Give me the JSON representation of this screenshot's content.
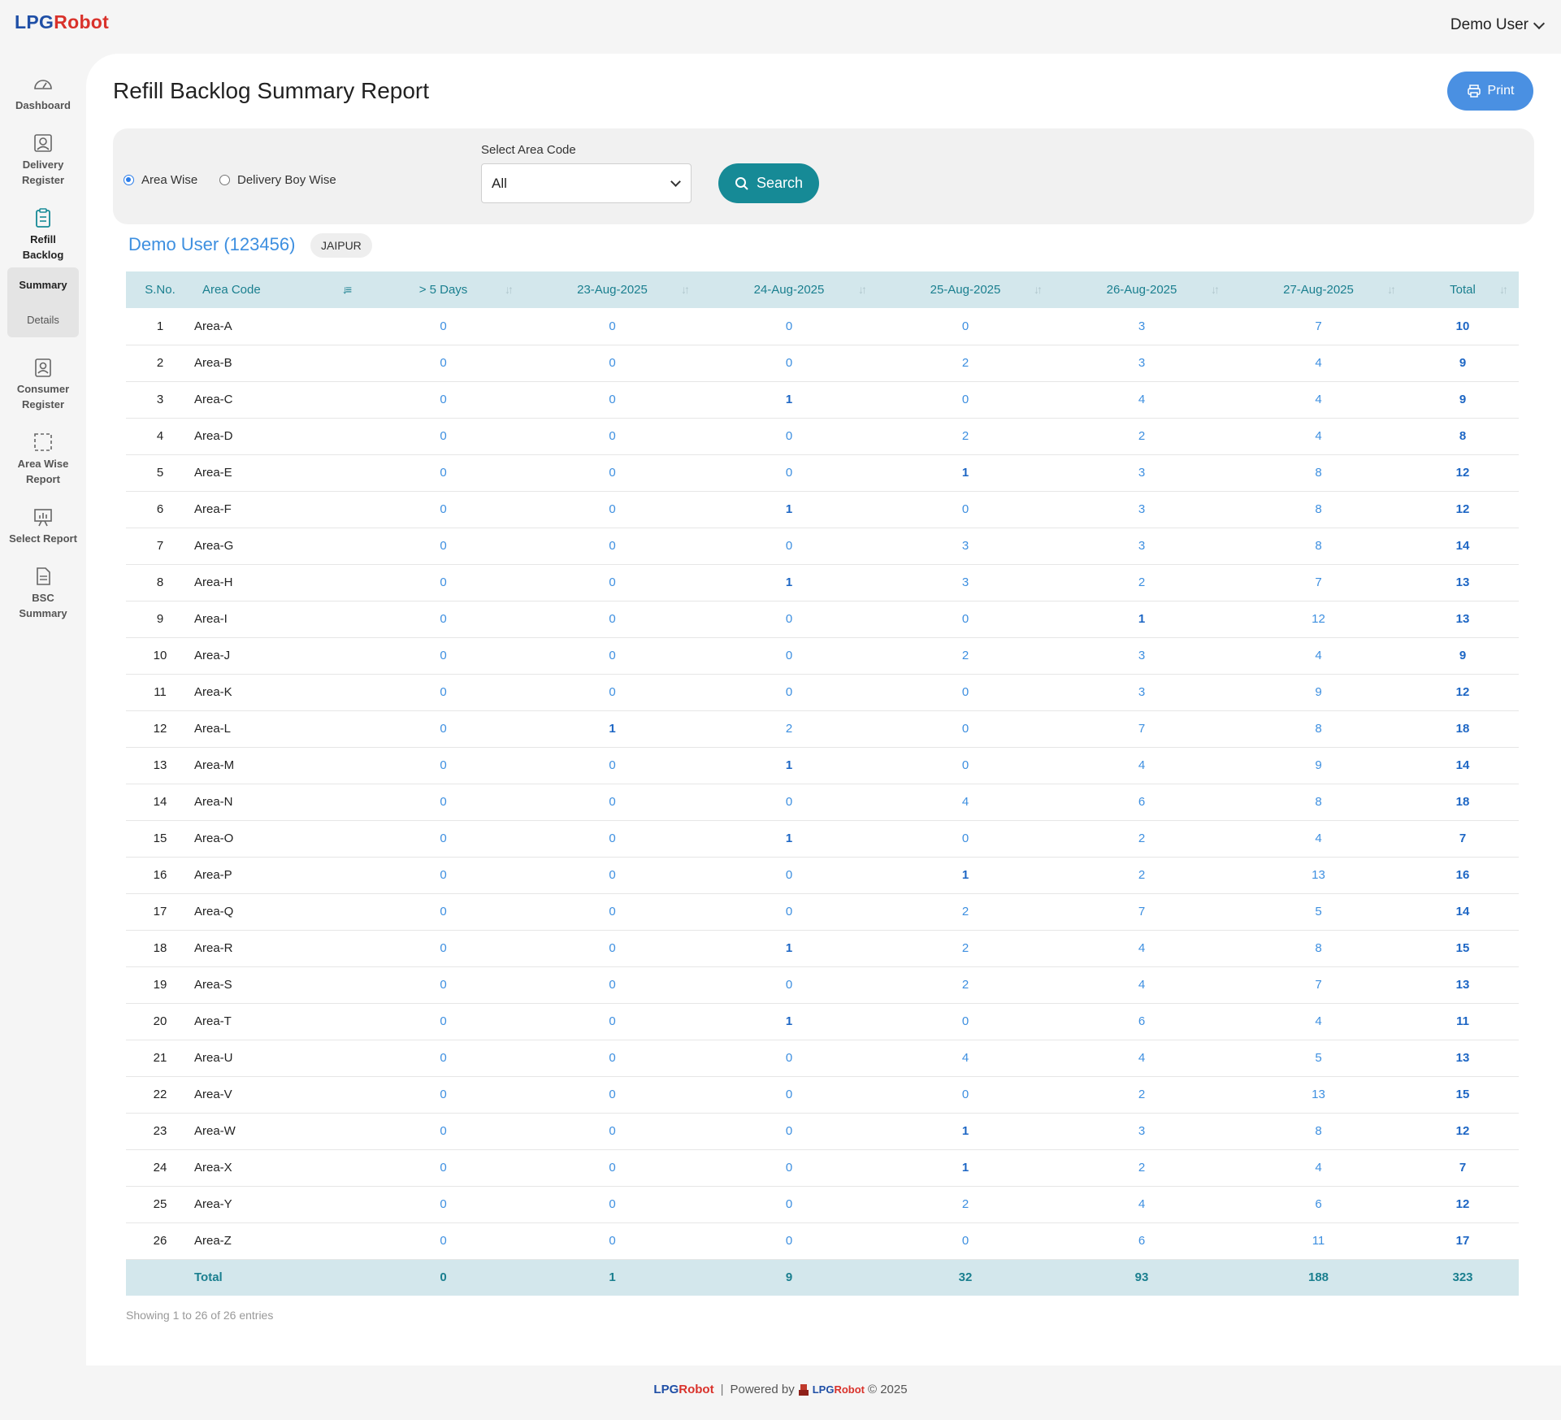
{
  "brand": {
    "lpg": "LPG",
    "robot": "Robot"
  },
  "user_menu": {
    "label": "Demo User"
  },
  "sidebar": {
    "items": [
      {
        "label_1": "Dashboard",
        "label_2": "",
        "icon": "dashboard-icon"
      },
      {
        "label_1": "Delivery",
        "label_2": "Register",
        "icon": "delivery-register-icon"
      },
      {
        "label_1": "Refill",
        "label_2": "Backlog",
        "icon": "clipboard-icon"
      },
      {
        "label_1": "Consumer",
        "label_2": "Register",
        "icon": "consumer-register-icon"
      },
      {
        "label_1": "Area Wise",
        "label_2": "Report",
        "icon": "area-select-icon"
      },
      {
        "label_1": "Select Report",
        "label_2": "",
        "icon": "presentation-chart-icon"
      },
      {
        "label_1": "BSC",
        "label_2": "Summary",
        "icon": "document-icon"
      }
    ],
    "sub": {
      "summary": "Summary",
      "details": "Details"
    }
  },
  "page": {
    "title": "Refill Backlog Summary Report",
    "print_label": "Print"
  },
  "filters": {
    "radio_area": "Area Wise",
    "radio_boy": "Delivery Boy Wise",
    "select_label": "Select Area Code",
    "select_value": "All",
    "search_label": "Search"
  },
  "report": {
    "user": "Demo User (123456)",
    "city": "JAIPUR"
  },
  "table": {
    "headers": [
      "S.No.",
      "Area Code",
      "> 5 Days",
      "23-Aug-2025",
      "24-Aug-2025",
      "25-Aug-2025",
      "26-Aug-2025",
      "27-Aug-2025",
      "Total"
    ],
    "rows": [
      [
        "1",
        "Area-A",
        "0",
        "0",
        "0",
        "0",
        "3",
        "7",
        "10"
      ],
      [
        "2",
        "Area-B",
        "0",
        "0",
        "0",
        "2",
        "3",
        "4",
        "9"
      ],
      [
        "3",
        "Area-C",
        "0",
        "0",
        "1",
        "0",
        "4",
        "4",
        "9"
      ],
      [
        "4",
        "Area-D",
        "0",
        "0",
        "0",
        "2",
        "2",
        "4",
        "8"
      ],
      [
        "5",
        "Area-E",
        "0",
        "0",
        "0",
        "1",
        "3",
        "8",
        "12"
      ],
      [
        "6",
        "Area-F",
        "0",
        "0",
        "1",
        "0",
        "3",
        "8",
        "12"
      ],
      [
        "7",
        "Area-G",
        "0",
        "0",
        "0",
        "3",
        "3",
        "8",
        "14"
      ],
      [
        "8",
        "Area-H",
        "0",
        "0",
        "1",
        "3",
        "2",
        "7",
        "13"
      ],
      [
        "9",
        "Area-I",
        "0",
        "0",
        "0",
        "0",
        "1",
        "12",
        "13"
      ],
      [
        "10",
        "Area-J",
        "0",
        "0",
        "0",
        "2",
        "3",
        "4",
        "9"
      ],
      [
        "11",
        "Area-K",
        "0",
        "0",
        "0",
        "0",
        "3",
        "9",
        "12"
      ],
      [
        "12",
        "Area-L",
        "0",
        "1",
        "2",
        "0",
        "7",
        "8",
        "18"
      ],
      [
        "13",
        "Area-M",
        "0",
        "0",
        "1",
        "0",
        "4",
        "9",
        "14"
      ],
      [
        "14",
        "Area-N",
        "0",
        "0",
        "0",
        "4",
        "6",
        "8",
        "18"
      ],
      [
        "15",
        "Area-O",
        "0",
        "0",
        "1",
        "0",
        "2",
        "4",
        "7"
      ],
      [
        "16",
        "Area-P",
        "0",
        "0",
        "0",
        "1",
        "2",
        "13",
        "16"
      ],
      [
        "17",
        "Area-Q",
        "0",
        "0",
        "0",
        "2",
        "7",
        "5",
        "14"
      ],
      [
        "18",
        "Area-R",
        "0",
        "0",
        "1",
        "2",
        "4",
        "8",
        "15"
      ],
      [
        "19",
        "Area-S",
        "0",
        "0",
        "0",
        "2",
        "4",
        "7",
        "13"
      ],
      [
        "20",
        "Area-T",
        "0",
        "0",
        "1",
        "0",
        "6",
        "4",
        "11"
      ],
      [
        "21",
        "Area-U",
        "0",
        "0",
        "0",
        "4",
        "4",
        "5",
        "13"
      ],
      [
        "22",
        "Area-V",
        "0",
        "0",
        "0",
        "0",
        "2",
        "13",
        "15"
      ],
      [
        "23",
        "Area-W",
        "0",
        "0",
        "0",
        "1",
        "3",
        "8",
        "12"
      ],
      [
        "24",
        "Area-X",
        "0",
        "0",
        "0",
        "1",
        "2",
        "4",
        "7"
      ],
      [
        "25",
        "Area-Y",
        "0",
        "0",
        "0",
        "2",
        "4",
        "6",
        "12"
      ],
      [
        "26",
        "Area-Z",
        "0",
        "0",
        "0",
        "0",
        "6",
        "11",
        "17"
      ]
    ],
    "total_row": [
      "",
      "Total",
      "0",
      "1",
      "9",
      "32",
      "93",
      "188",
      "323"
    ],
    "entries_text": "Showing 1 to 26 of 26 entries"
  },
  "footer": {
    "powered": "Powered by",
    "year": "© 2025"
  },
  "colors": {
    "accent": "#168a96",
    "link": "#3d8fe0",
    "header_bg": "#d3e7ec",
    "print": "#4a90e2"
  }
}
